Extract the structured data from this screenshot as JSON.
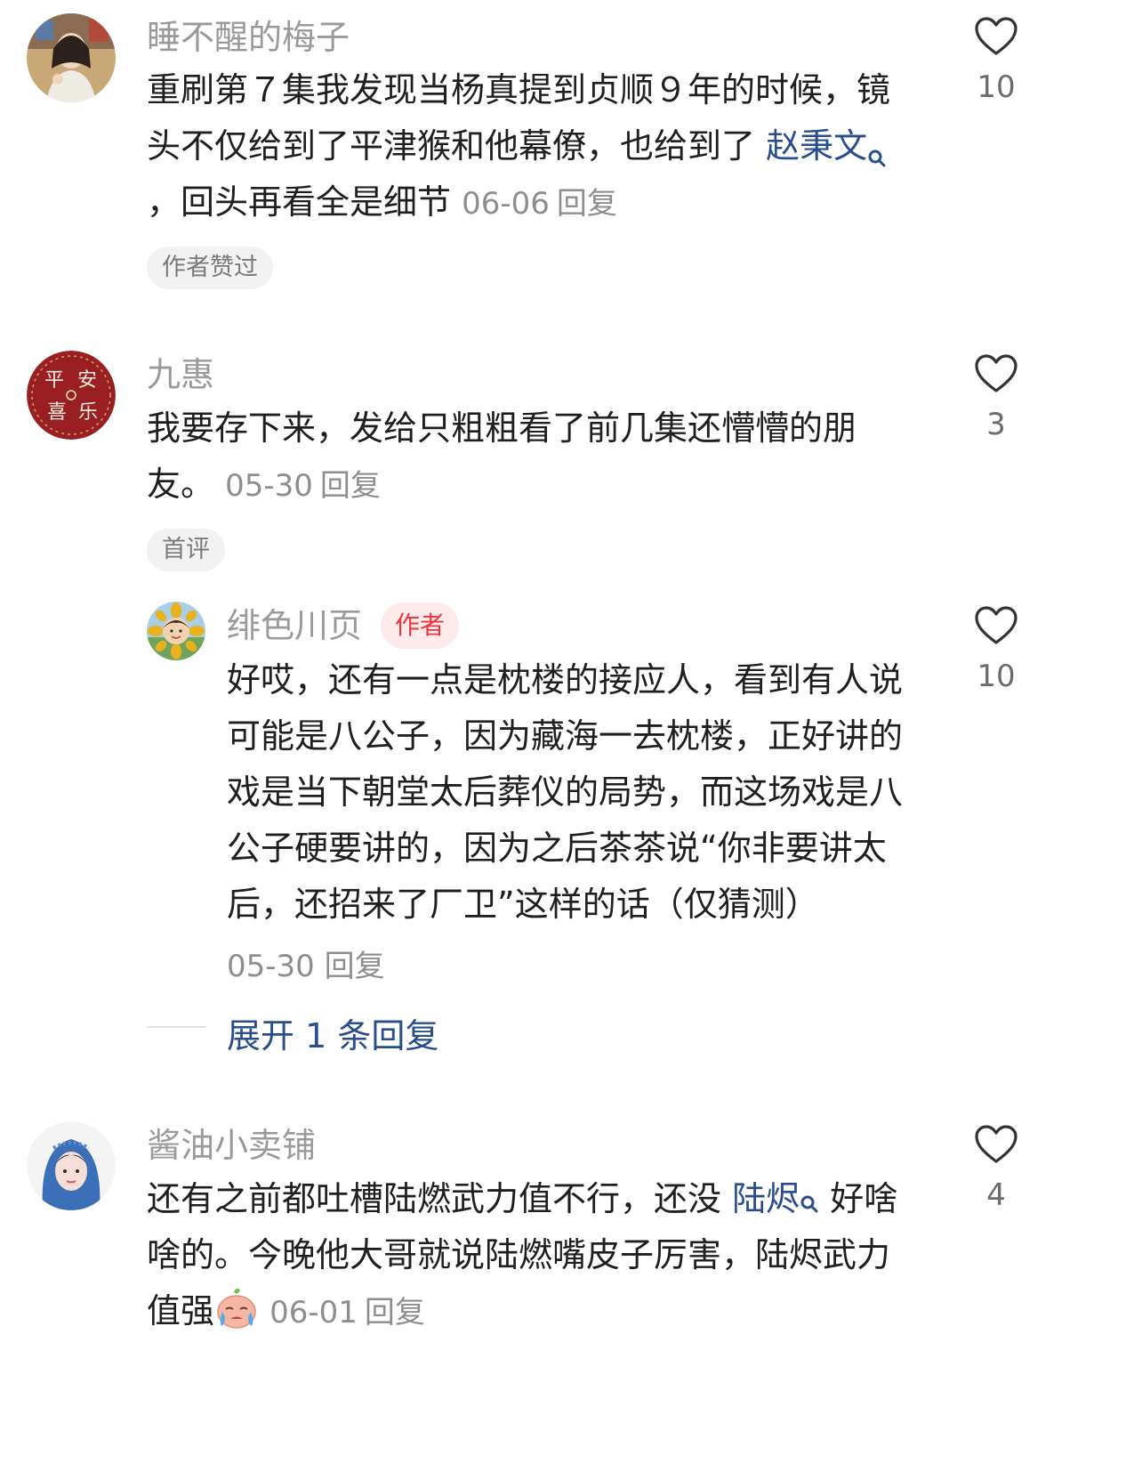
{
  "comments": [
    {
      "username": "睡不醒的梅子",
      "text_before_link": "重刷第７集我发现当杨真提到贞顺９年的时候，镜头不仅给到了平津猴和他幕僚，也给到了 ",
      "link_text": "赵秉文",
      "text_after_link": "，回头再看全是细节",
      "date": "06-06",
      "reply_label": "回复",
      "tag": "作者赞过",
      "likes": "10"
    },
    {
      "username": "九惠",
      "avatar_text": [
        "平",
        "安",
        "喜",
        "乐"
      ],
      "text": "我要存下来，发给只粗粗看了前几集还懵懵的朋友。",
      "date": "05-30",
      "reply_label": "回复",
      "tag": "首评",
      "likes": "3",
      "reply": {
        "username": "绯色川页",
        "badge": "作者",
        "text": "好哎，还有一点是枕楼的接应人，看到有人说可能是八公子，因为藏海一去枕楼，正好讲的戏是当下朝堂太后葬仪的局势，而这场戏是八公子硬要讲的，因为之后茶茶说“你非要讲太后，还招来了厂卫”这样的话（仅猜测）",
        "date": "05-30",
        "reply_label": "回复",
        "likes": "10"
      },
      "expand_label": "展开 1 条回复"
    },
    {
      "username": "酱油小卖铺",
      "text_before_link": "还有之前都吐槽陆燃武力值不行，还没 ",
      "link_text": "陆烬",
      "text_after_link": " 好啥啥的。今晚他大哥就说陆燃嘴皮子厉害，陆烬武力值强",
      "date": "06-01",
      "reply_label": "回复",
      "likes": "4"
    }
  ],
  "icons": {
    "like": "heart-outline-icon",
    "search": "search-icon",
    "emoji": "crying-emoji-icon"
  },
  "colors": {
    "link": "#2a4e8c",
    "author_badge_text": "#e8363d",
    "author_badge_bg": "#fdeaea"
  }
}
